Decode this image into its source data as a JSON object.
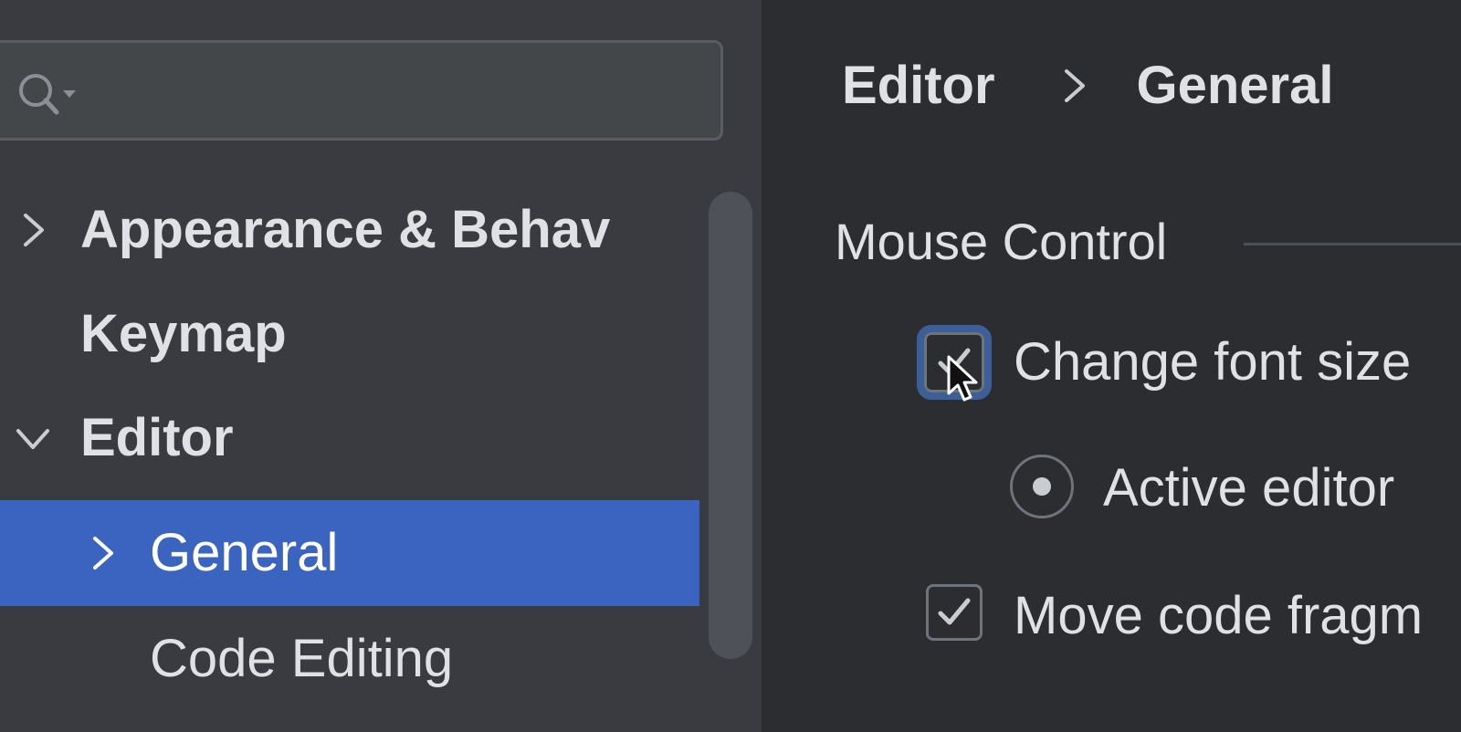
{
  "colors": {
    "sidebar_bg": "#393b40",
    "content_bg": "#2b2d30",
    "selection": "#3b63c0",
    "text": "#dfe1e5",
    "focus_ring": "#3c5f99"
  },
  "search": {
    "icon": "search-icon",
    "value": "",
    "placeholder": ""
  },
  "sidebar": {
    "items": [
      {
        "label": "Appearance & Behav",
        "expander": "chevron-right-icon",
        "bold": true,
        "selected": false
      },
      {
        "label": "Keymap",
        "expander": null,
        "bold": true,
        "selected": false
      },
      {
        "label": "Editor",
        "expander": "chevron-down-icon",
        "bold": true,
        "selected": false
      },
      {
        "label": "General",
        "expander": "chevron-right-icon",
        "bold": false,
        "selected": true
      },
      {
        "label": "Code Editing",
        "expander": null,
        "bold": false,
        "selected": false
      }
    ]
  },
  "breadcrumb": {
    "items": [
      "Editor",
      "General"
    ],
    "separator_icon": "chevron-right-icon"
  },
  "section": {
    "title": "Mouse Control"
  },
  "options": {
    "change_font_size": {
      "label": "Change font size",
      "checked": true,
      "focused": true
    },
    "active_editor": {
      "label": "Active editor",
      "selected": true
    },
    "move_code_fragments": {
      "label": "Move code fragm",
      "checked": true
    }
  }
}
